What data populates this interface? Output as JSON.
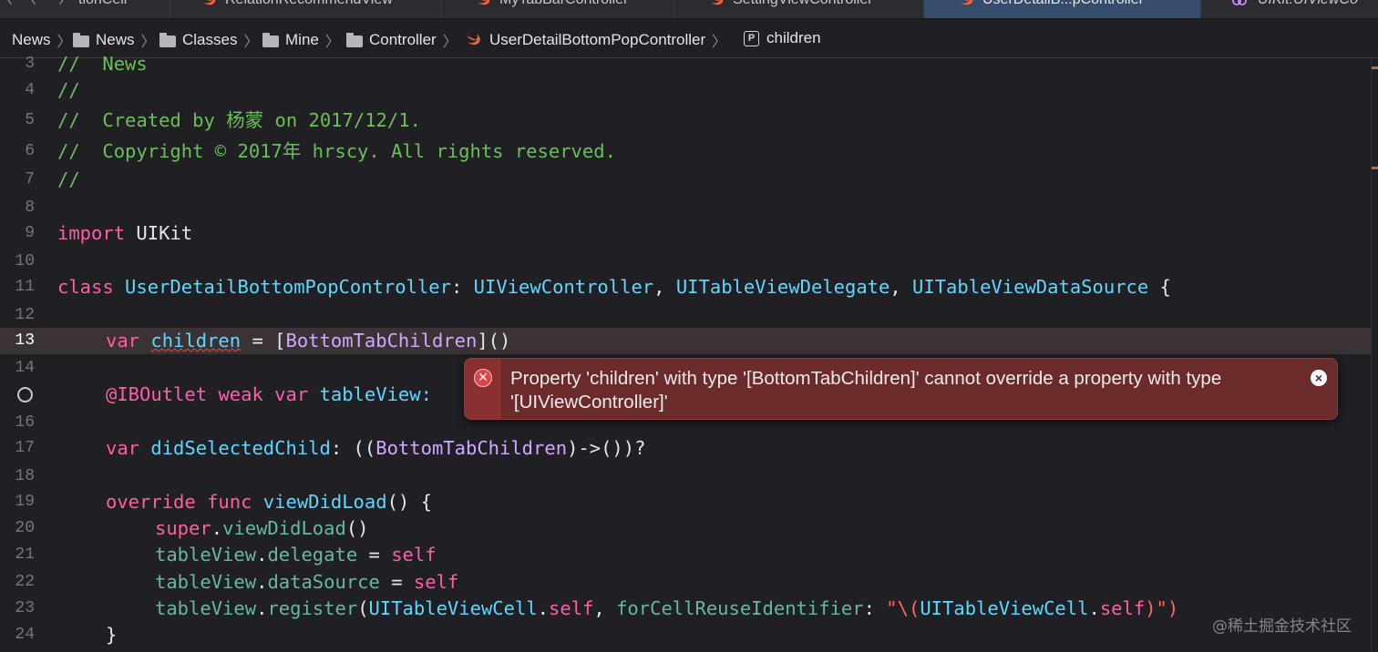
{
  "tabs": [
    {
      "label": "tionCell",
      "active": false
    },
    {
      "label": "RelationRecommendView",
      "active": false
    },
    {
      "label": "MyTabBarController",
      "active": false
    },
    {
      "label": "SettingViewController",
      "active": false
    },
    {
      "label": "UserDetailB...pController",
      "active": true
    },
    {
      "label": "UIKit.UIViewCo",
      "active": false
    }
  ],
  "breadcrumb": {
    "items": [
      "News",
      "News",
      "Classes",
      "Mine",
      "Controller",
      "UserDetailBottomPopController",
      "children"
    ],
    "property_badge": "P"
  },
  "editor": {
    "current_line": "13",
    "lines": [
      {
        "n": "3"
      },
      {
        "n": "4"
      },
      {
        "n": "5"
      },
      {
        "n": "6"
      },
      {
        "n": "7"
      },
      {
        "n": "8"
      },
      {
        "n": "9"
      },
      {
        "n": "10"
      },
      {
        "n": "11"
      },
      {
        "n": "12"
      },
      {
        "n": "13"
      },
      {
        "n": "14"
      },
      {
        "n": "16"
      },
      {
        "n": "17"
      },
      {
        "n": "18"
      },
      {
        "n": "19"
      },
      {
        "n": "20"
      },
      {
        "n": "21"
      },
      {
        "n": "22"
      },
      {
        "n": "23"
      },
      {
        "n": "24"
      }
    ],
    "code": {
      "l3": "//  News",
      "l4": "//",
      "l5": "//  Created by 杨蒙 on 2017/12/1.",
      "l6": "//  Copyright © 2017年 hrscy. All rights reserved.",
      "l7": "//",
      "l9_kw": "import",
      "l9_mod": " UIKit",
      "l11_kw": "class",
      "l11_name": " UserDetailBottomPopController",
      "l11_colon": ": ",
      "l11_t1": "UIViewController",
      "l11_c1": ", ",
      "l11_t2": "UITableViewDelegate",
      "l11_c2": ", ",
      "l11_t3": "UITableViewDataSource",
      "l11_brace": " {",
      "l13_kw": "var",
      "l13_name": "children",
      "l13_eq": " = [",
      "l13_type": "BottomTabChildren",
      "l13_end": "]()",
      "l15_attr": "@IBOutlet",
      "l15_weak": "weak",
      "l15_var": "var",
      "l15_name": "tableView:",
      "l17_kw": "var",
      "l17_name": " didSelectedChild",
      "l17_p1": ": ((",
      "l17_type": "BottomTabChildren",
      "l17_p2": ")->())?",
      "l19_kw": "override",
      "l19_func": "func",
      "l19_name": " viewDidLoad",
      "l19_p": "() {",
      "l20_super": "super",
      "l20_dot": ".",
      "l20_call": "viewDidLoad",
      "l20_p": "()",
      "l21_obj": "tableView",
      "l21_dot": ".",
      "l21_prop": "delegate",
      "l21_eq": " = ",
      "l21_self": "self",
      "l22_obj": "tableView",
      "l22_dot": ".",
      "l22_prop": "dataSource",
      "l22_eq": " = ",
      "l22_self": "self",
      "l23_obj": "tableView",
      "l23_dot": ".",
      "l23_call": "register",
      "l23_p1": "(",
      "l23_t": "UITableViewCell",
      "l23_dot2": ".",
      "l23_self": "self",
      "l23_c": ", ",
      "l23_arg": "forCellReuseIdentifier",
      "l23_colon": ": ",
      "l23_q1": "\"\\(",
      "l23_t2": "UITableViewCell",
      "l23_dot3": ".",
      "l23_self2": "self",
      "l23_q2": ")\")",
      "l24": "}"
    }
  },
  "error": {
    "message": "Property 'children' with type '[BottomTabChildren]' cannot override a property with type '[UIViewController]'",
    "icon": "error-x-icon",
    "close": "×"
  },
  "watermark": "@稀土掘金技术社区",
  "colors": {
    "comment": "#6bbf59",
    "keyword": "#fc5fa3",
    "type": "#5dd8ff",
    "error_bg": "#6b2b2b"
  }
}
